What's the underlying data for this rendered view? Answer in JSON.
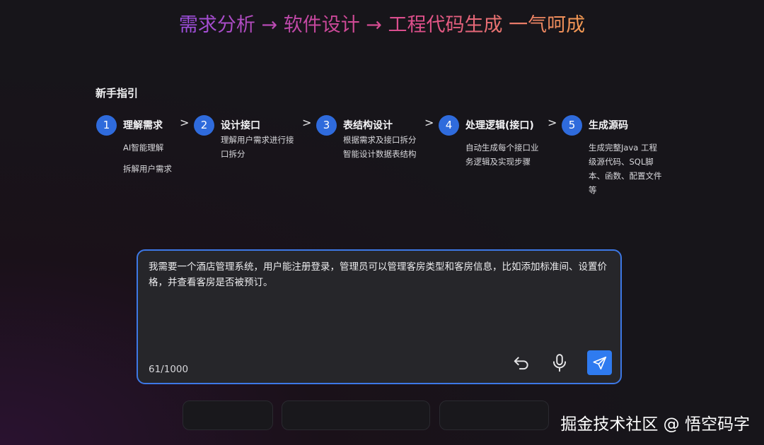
{
  "hero": {
    "title": "需求分析 → 软件设计 → 工程代码生成 一气呵成"
  },
  "guide": {
    "title": "新手指引",
    "separator": ">",
    "steps": [
      {
        "num": "1",
        "title": "理解需求",
        "lines": [
          "AI智能理解",
          "",
          "拆解用户需求"
        ]
      },
      {
        "num": "2",
        "title": "设计接口",
        "lines": [
          "理解用户需求进行接",
          "口拆分"
        ]
      },
      {
        "num": "3",
        "title": "表结构设计",
        "lines": [
          "根据需求及接口拆分",
          "智能设计数据表结构"
        ]
      },
      {
        "num": "4",
        "title": "处理逻辑(接口)",
        "lines": [
          "自动生成每个接口业",
          "务逻辑及实现步骤"
        ]
      },
      {
        "num": "5",
        "title": "生成源码",
        "lines": [
          "生成完整Java 工程",
          "级源代码、SQL脚",
          "本、函数、配置文件",
          "等"
        ]
      }
    ]
  },
  "input": {
    "value": "我需要一个酒店管理系统，用户能注册登录，管理员可以管理客房类型和客房信息，比如添加标准间、设置价格，并查看客房是否被预订。",
    "counter": "61/1000"
  },
  "icons": {
    "undo": "undo-icon",
    "mic": "microphone-icon",
    "send": "send-icon"
  },
  "colors": {
    "accent": "#2f6bdc",
    "send_button": "#2f7bf0",
    "input_border": "#3d78e6"
  },
  "watermark": "掘金技术社区 @ 悟空码字"
}
